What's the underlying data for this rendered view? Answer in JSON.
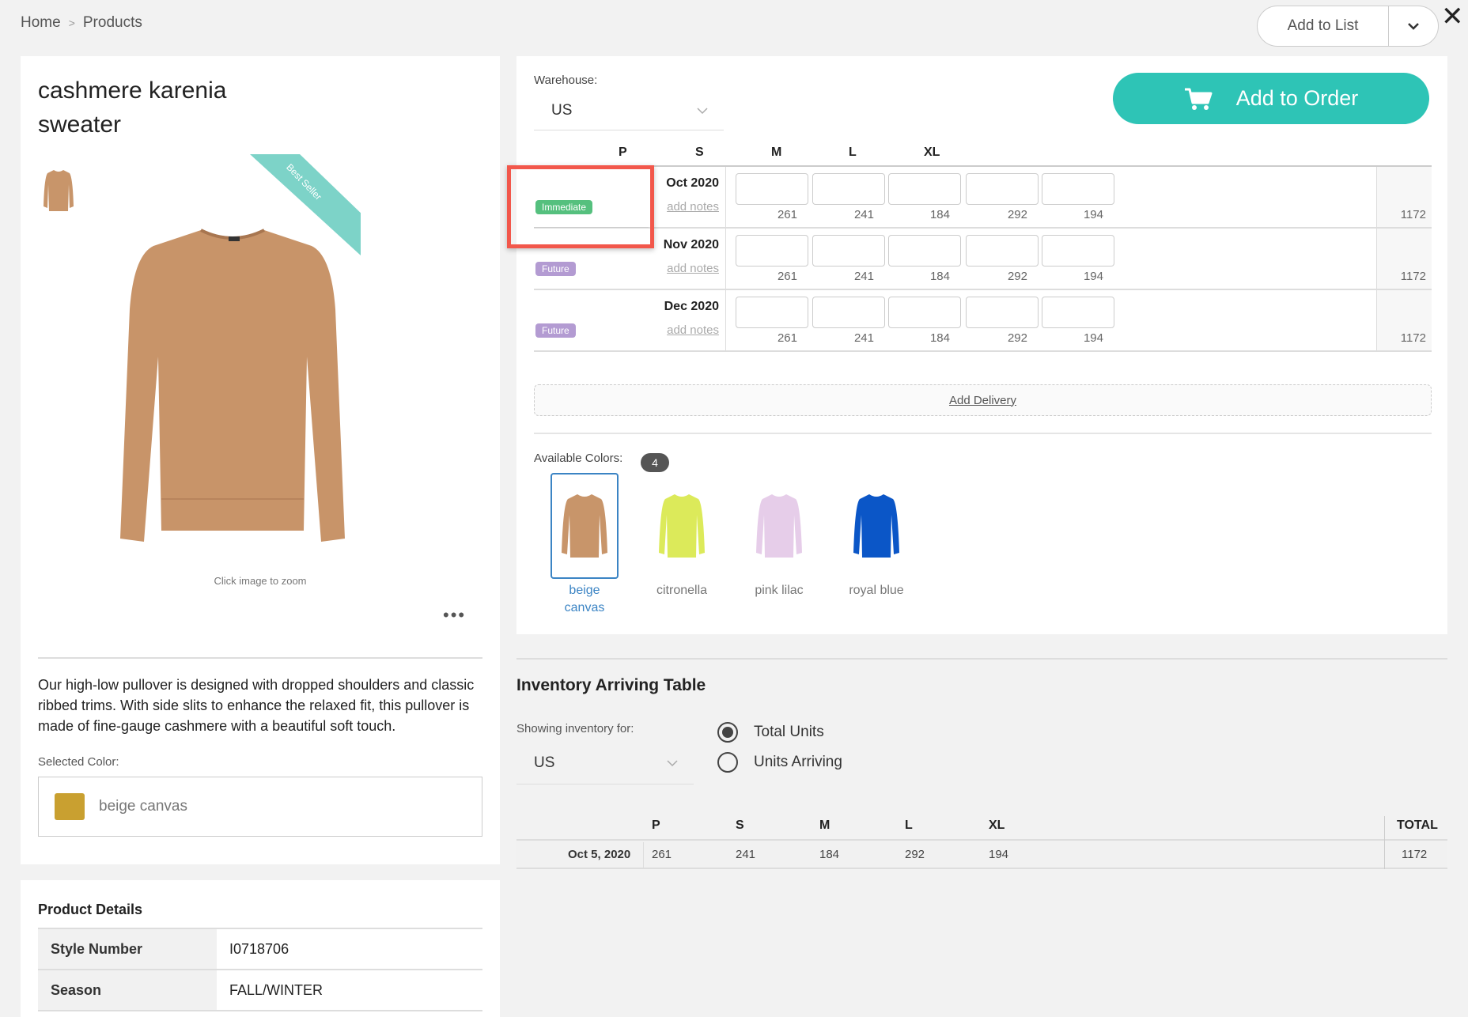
{
  "breadcrumb": {
    "home": "Home",
    "separator": ">",
    "current": "Products"
  },
  "top_actions": {
    "add_to_list": "Add to List"
  },
  "product": {
    "title": "cashmere karenia sweater",
    "ribbon": "Best Seller",
    "zoom_hint": "Click image to zoom",
    "more": "•••",
    "description": "Our high-low pullover is designed with dropped shoulders and classic ribbed trims. With side slits to enhance the relaxed fit, this pullover is made of fine-gauge cashmere with a beautiful soft touch.",
    "selected_color_label": "Selected Color:",
    "selected_color": "beige canvas",
    "swatch_color": "#c9a030"
  },
  "details": {
    "title": "Product Details",
    "rows": [
      {
        "key": "Style Number",
        "value": "I0718706"
      },
      {
        "key": "Season",
        "value": "FALL/WINTER"
      }
    ]
  },
  "order": {
    "warehouse_label": "Warehouse:",
    "warehouse_value": "US",
    "add_to_order": "Add to Order",
    "sizes": [
      "P",
      "S",
      "M",
      "L",
      "XL"
    ],
    "deliveries": [
      {
        "date": "Oct 2020",
        "badge": "Immediate",
        "notes": "add notes",
        "avail": [
          "261",
          "241",
          "184",
          "292",
          "194"
        ],
        "total": "1172"
      },
      {
        "date": "Nov 2020",
        "badge": "Future",
        "notes": "add notes",
        "avail": [
          "261",
          "241",
          "184",
          "292",
          "194"
        ],
        "total": "1172"
      },
      {
        "date": "Dec 2020",
        "badge": "Future",
        "notes": "add notes",
        "avail": [
          "261",
          "241",
          "184",
          "292",
          "194"
        ],
        "total": "1172"
      }
    ],
    "add_delivery": "Add Delivery",
    "colors_label": "Available Colors:",
    "colors_count": "4",
    "colors": [
      {
        "name": "beige canvas",
        "hex": "#c8956a",
        "selected": true
      },
      {
        "name": "citronella",
        "hex": "#dcea5a",
        "selected": false
      },
      {
        "name": "pink lilac",
        "hex": "#e6cde9",
        "selected": false
      },
      {
        "name": "royal blue",
        "hex": "#0b56c7",
        "selected": false
      }
    ]
  },
  "inventory": {
    "title": "Inventory Arriving Table",
    "showing_label": "Showing inventory for:",
    "showing_value": "US",
    "radio_total": "Total Units",
    "radio_arriving": "Units Arriving",
    "columns": [
      "P",
      "S",
      "M",
      "L",
      "XL"
    ],
    "total_header": "TOTAL",
    "row": {
      "date": "Oct 5, 2020",
      "values": [
        "261",
        "241",
        "184",
        "292",
        "194"
      ],
      "total": "1172"
    }
  },
  "colors": {
    "accent": "#2ec4b6",
    "immediate": "#55c07e",
    "future": "#b39bd2",
    "highlight": "#f2574b"
  }
}
